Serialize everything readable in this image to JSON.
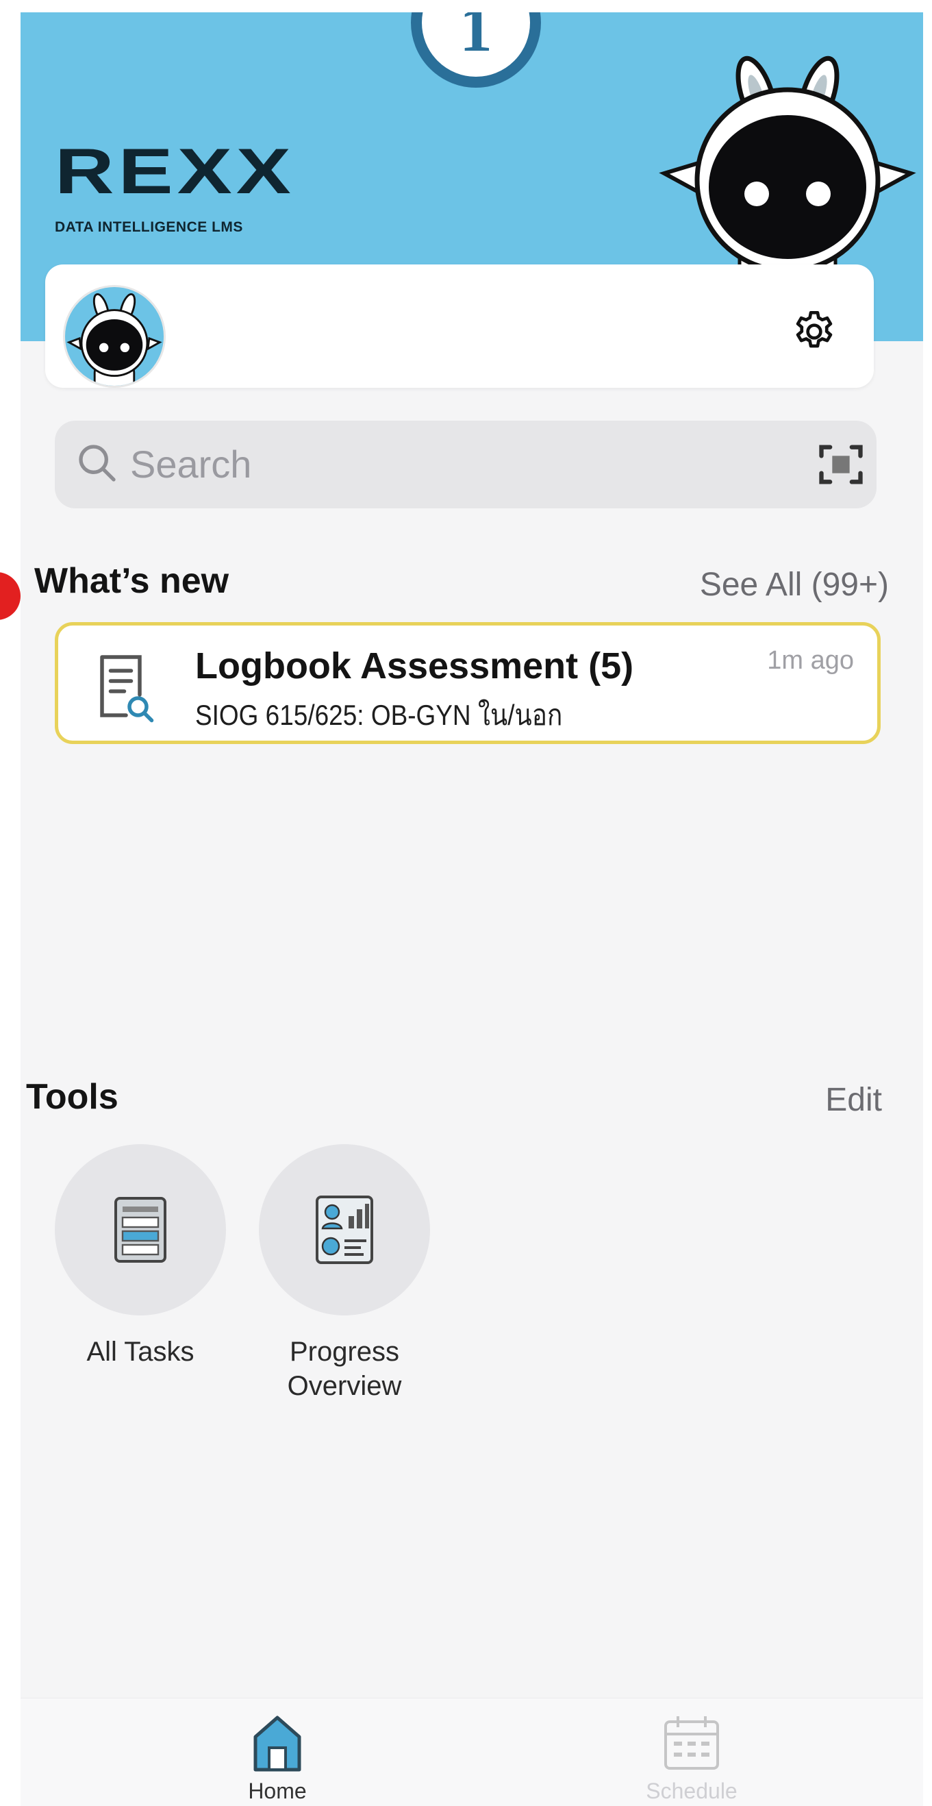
{
  "step_marker": "1",
  "brand": {
    "logo_word": "REXX",
    "logo_tagline": "DATA INTELLIGENCE LMS"
  },
  "search": {
    "placeholder": "Search"
  },
  "whats_new": {
    "title": "What’s new",
    "see_all": "See All (99+)",
    "items": [
      {
        "title": "Logbook Assessment (5)",
        "subtitle": "SIOG 615/625: OB-GYN ใน/นอก",
        "time": "1m ago"
      }
    ]
  },
  "tools": {
    "title": "Tools",
    "edit": "Edit",
    "items": [
      {
        "label": "All Tasks"
      },
      {
        "label": "Progress Overview"
      }
    ]
  },
  "bottom_nav": {
    "items": [
      {
        "label": "Home",
        "active": true
      },
      {
        "label": "Schedule",
        "active": false
      }
    ]
  },
  "colors": {
    "hero": "#6cc3e6",
    "card_border": "#e8d25a",
    "accent": "#2a6f99",
    "home_icon": "#4aa9d6"
  }
}
